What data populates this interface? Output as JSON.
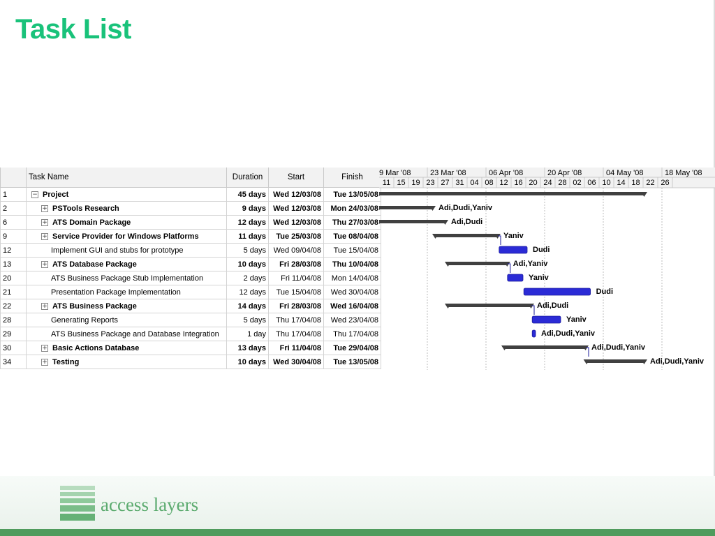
{
  "slide": {
    "title": "Task List"
  },
  "colors": {
    "title": "#19c27a",
    "summary_bar": "#404040",
    "task_bar": "#2b2bd6",
    "logo": "#5cab6f"
  },
  "table": {
    "headers": {
      "id": "",
      "name": "Task Name",
      "duration": "Duration",
      "start": "Start",
      "finish": "Finish"
    },
    "rows": [
      {
        "id": "1",
        "name": "Project",
        "duration": "45 days",
        "start": "Wed 12/03/08",
        "finish": "Tue 13/05/08",
        "summary": true,
        "expander": "−",
        "level": 0
      },
      {
        "id": "2",
        "name": "PSTools Research",
        "duration": "9 days",
        "start": "Wed 12/03/08",
        "finish": "Mon 24/03/08",
        "summary": true,
        "expander": "+",
        "level": 1
      },
      {
        "id": "6",
        "name": "ATS Domain Package",
        "duration": "12 days",
        "start": "Wed 12/03/08",
        "finish": "Thu 27/03/08",
        "summary": true,
        "expander": "+",
        "level": 1
      },
      {
        "id": "9",
        "name": "Service Provider for Windows Platforms",
        "duration": "11 days",
        "start": "Tue 25/03/08",
        "finish": "Tue 08/04/08",
        "summary": true,
        "expander": "+",
        "level": 1
      },
      {
        "id": "12",
        "name": "Implement GUI and stubs for prototype",
        "duration": "5 days",
        "start": "Wed 09/04/08",
        "finish": "Tue 15/04/08",
        "summary": false,
        "expander": "",
        "level": 2
      },
      {
        "id": "13",
        "name": "ATS Database Package",
        "duration": "10 days",
        "start": "Fri 28/03/08",
        "finish": "Thu 10/04/08",
        "summary": true,
        "expander": "+",
        "level": 1
      },
      {
        "id": "20",
        "name": "ATS Business Package Stub Implementation",
        "duration": "2 days",
        "start": "Fri 11/04/08",
        "finish": "Mon 14/04/08",
        "summary": false,
        "expander": "",
        "level": 2
      },
      {
        "id": "21",
        "name": "Presentation Package Implementation",
        "duration": "12 days",
        "start": "Tue 15/04/08",
        "finish": "Wed 30/04/08",
        "summary": false,
        "expander": "",
        "level": 2
      },
      {
        "id": "22",
        "name": "ATS Business Package",
        "duration": "14 days",
        "start": "Fri 28/03/08",
        "finish": "Wed 16/04/08",
        "summary": true,
        "expander": "+",
        "level": 1
      },
      {
        "id": "28",
        "name": "Generating Reports",
        "duration": "5 days",
        "start": "Thu 17/04/08",
        "finish": "Wed 23/04/08",
        "summary": false,
        "expander": "",
        "level": 2
      },
      {
        "id": "29",
        "name": "ATS Business Package and Database Integration",
        "duration": "1 day",
        "start": "Thu 17/04/08",
        "finish": "Thu 17/04/08",
        "summary": false,
        "expander": "",
        "level": 2
      },
      {
        "id": "30",
        "name": "Basic Actions Database",
        "duration": "13 days",
        "start": "Fri 11/04/08",
        "finish": "Tue 29/04/08",
        "summary": true,
        "expander": "+",
        "level": 1
      },
      {
        "id": "34",
        "name": "Testing",
        "duration": "10 days",
        "start": "Wed 30/04/08",
        "finish": "Tue 13/05/08",
        "summary": true,
        "expander": "+",
        "level": 1
      }
    ]
  },
  "gantt": {
    "week_labels": [
      "9 Mar '08",
      "23 Mar '08",
      "06 Apr '08",
      "20 Apr '08",
      "04 May '08",
      "18 May '08"
    ],
    "day_labels": [
      "11",
      "15",
      "19",
      "23",
      "27",
      "31",
      "04",
      "08",
      "12",
      "16",
      "20",
      "24",
      "28",
      "02",
      "06",
      "10",
      "14",
      "18",
      "22",
      "26"
    ],
    "bars": [
      {
        "row": 0,
        "start_day": 1.0,
        "end_day": 64.5,
        "type": "summary",
        "label": ""
      },
      {
        "row": 1,
        "start_day": 1.0,
        "end_day": 14.0,
        "type": "summary",
        "label": "Adi,Dudi,Yaniv"
      },
      {
        "row": 2,
        "start_day": 1.0,
        "end_day": 17.0,
        "type": "summary",
        "label": "Adi,Dudi"
      },
      {
        "row": 3,
        "start_day": 14.5,
        "end_day": 29.5,
        "type": "summary",
        "label": "Yaniv"
      },
      {
        "row": 4,
        "start_day": 29.8,
        "end_day": 36.5,
        "type": "task",
        "label": "Dudi"
      },
      {
        "row": 5,
        "start_day": 17.5,
        "end_day": 31.8,
        "type": "summary",
        "label": "Adi,Yaniv"
      },
      {
        "row": 6,
        "start_day": 31.8,
        "end_day": 35.5,
        "type": "task",
        "label": "Yaniv"
      },
      {
        "row": 7,
        "start_day": 35.7,
        "end_day": 51.6,
        "type": "task",
        "label": "Dudi"
      },
      {
        "row": 8,
        "start_day": 17.5,
        "end_day": 37.5,
        "type": "summary",
        "label": "Adi,Dudi"
      },
      {
        "row": 9,
        "start_day": 37.7,
        "end_day": 44.5,
        "type": "task",
        "label": "Yaniv"
      },
      {
        "row": 10,
        "start_day": 37.7,
        "end_day": 38.5,
        "type": "task",
        "label": "Adi,Dudi,Yaniv"
      },
      {
        "row": 11,
        "start_day": 31.0,
        "end_day": 50.5,
        "type": "summary",
        "label": "Adi,Dudi,Yaniv"
      },
      {
        "row": 12,
        "start_day": 50.6,
        "end_day": 64.5,
        "type": "summary",
        "label": "Adi,Dudi,Yaniv"
      }
    ]
  },
  "footer": {
    "logo_text": "access layers"
  }
}
